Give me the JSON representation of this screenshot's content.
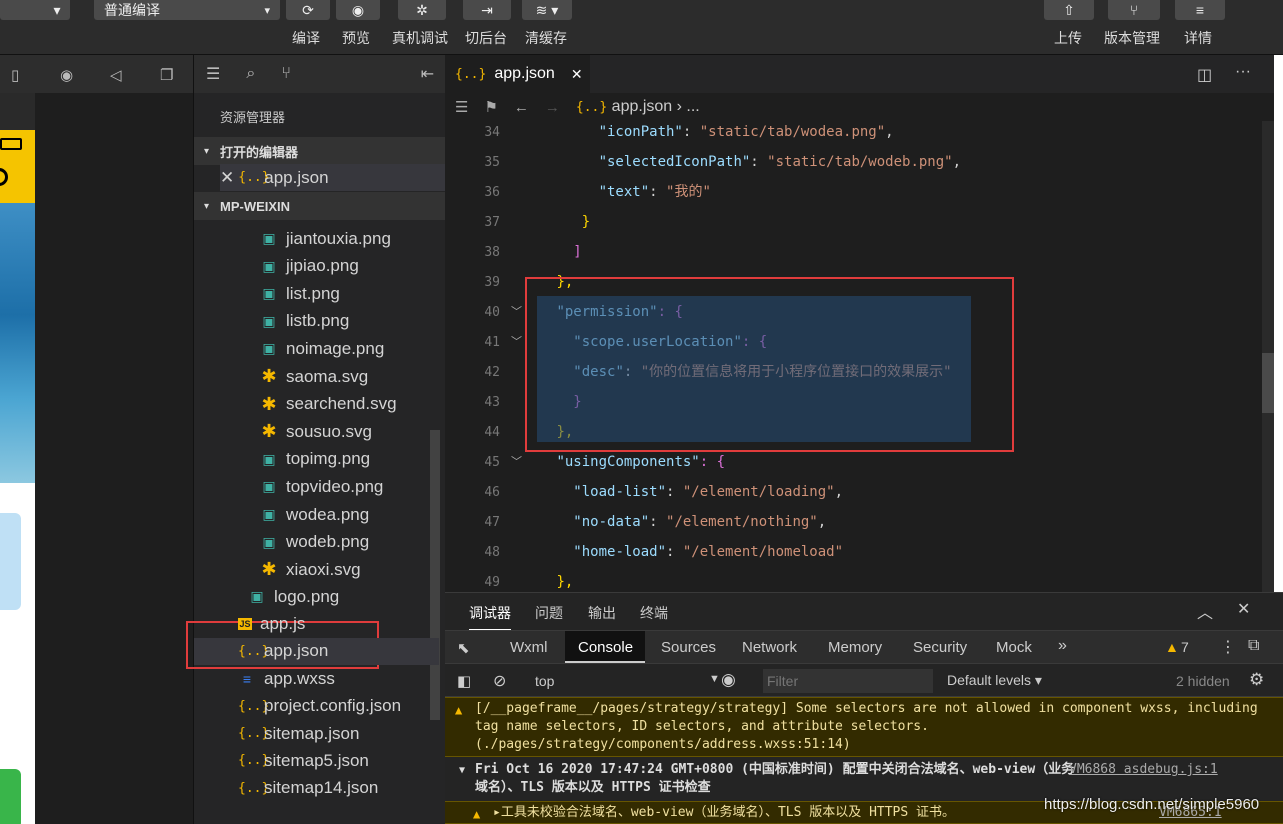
{
  "toolbar": {
    "compile_mode": "普通编译",
    "buttons": [
      "编译",
      "预览",
      "真机调试",
      "切后台",
      "清缓存"
    ],
    "right_buttons": [
      "上传",
      "版本管理",
      "详情"
    ]
  },
  "explorer": {
    "title": "资源管理器",
    "open_editors": "打开的编辑器",
    "open_file": "app.json",
    "project": "MP-WEIXIN",
    "files": [
      {
        "name": "jiantouxia.png",
        "type": "img"
      },
      {
        "name": "jipiao.png",
        "type": "img"
      },
      {
        "name": "list.png",
        "type": "img"
      },
      {
        "name": "listb.png",
        "type": "img"
      },
      {
        "name": "noimage.png",
        "type": "img"
      },
      {
        "name": "saoma.svg",
        "type": "svg"
      },
      {
        "name": "searchend.svg",
        "type": "svg"
      },
      {
        "name": "sousuo.svg",
        "type": "svg"
      },
      {
        "name": "topimg.png",
        "type": "img"
      },
      {
        "name": "topvideo.png",
        "type": "img"
      },
      {
        "name": "wodea.png",
        "type": "img"
      },
      {
        "name": "wodeb.png",
        "type": "img"
      },
      {
        "name": "xiaoxi.svg",
        "type": "svg"
      }
    ],
    "root_files": [
      {
        "name": "logo.png",
        "type": "img"
      },
      {
        "name": "app.js",
        "type": "js"
      },
      {
        "name": "app.json",
        "type": "json"
      },
      {
        "name": "app.wxss",
        "type": "css"
      },
      {
        "name": "project.config.json",
        "type": "json"
      },
      {
        "name": "sitemap.json",
        "type": "json"
      },
      {
        "name": "sitemap5.json",
        "type": "json"
      },
      {
        "name": "sitemap14.json",
        "type": "json"
      }
    ]
  },
  "editor": {
    "tab": "app.json",
    "breadcrumb": "app.json",
    "breadcrumb_more": "...",
    "lines": [
      {
        "n": "34",
        "indent": "      ",
        "key": "\"iconPath\"",
        "val": "\"static/tab/wodea.png\"",
        "tail": ","
      },
      {
        "n": "35",
        "indent": "      ",
        "key": "\"selectedIconPath\"",
        "val": "\"static/tab/wodeb.png\"",
        "tail": ","
      },
      {
        "n": "36",
        "indent": "      ",
        "key": "\"text\"",
        "val": "\"我的\"",
        "tail": ""
      },
      {
        "n": "37",
        "indent": "    ",
        "key": "",
        "val": "",
        "tail": "}"
      },
      {
        "n": "38",
        "indent": "   ",
        "key": "",
        "val": "",
        "tail": "]"
      },
      {
        "n": "39",
        "indent": " ",
        "key": "",
        "val": "",
        "tail": "},"
      },
      {
        "n": "40",
        "indent": " ",
        "key": "\"permission\"",
        "val": "",
        "tail": ": {"
      },
      {
        "n": "41",
        "indent": "   ",
        "key": "\"scope.userLocation\"",
        "val": "",
        "tail": ": {"
      },
      {
        "n": "42",
        "indent": "   ",
        "key": "\"desc\"",
        "val": "\"你的位置信息将用于小程序位置接口的效果展示\"",
        "tail": ""
      },
      {
        "n": "43",
        "indent": "   ",
        "key": "",
        "val": "",
        "tail": "}"
      },
      {
        "n": "44",
        "indent": " ",
        "key": "",
        "val": "",
        "tail": "},"
      },
      {
        "n": "45",
        "indent": " ",
        "key": "\"usingComponents\"",
        "val": "",
        "tail": ": {"
      },
      {
        "n": "46",
        "indent": "   ",
        "key": "\"load-list\"",
        "val": "\"/element/loading\"",
        "tail": ","
      },
      {
        "n": "47",
        "indent": "   ",
        "key": "\"no-data\"",
        "val": "\"/element/nothing\"",
        "tail": ","
      },
      {
        "n": "48",
        "indent": "   ",
        "key": "\"home-load\"",
        "val": "\"/element/homeload\"",
        "tail": ""
      },
      {
        "n": "49",
        "indent": " ",
        "key": "",
        "val": "",
        "tail": "},"
      }
    ]
  },
  "devtools": {
    "tabs": [
      "调试器",
      "问题",
      "输出",
      "终端"
    ],
    "panels": [
      "Wxml",
      "Console",
      "Sources",
      "Network",
      "Memory",
      "Security",
      "Mock"
    ],
    "warn_count": "7",
    "context": "top",
    "filter_placeholder": "Filter",
    "levels": "Default levels",
    "hidden": "2 hidden",
    "msg1": "[/__pageframe__/pages/strategy/strategy] Some selectors are not allowed in component wxss, including tag name selectors, ID selectors, and attribute selectors.(./pages/strategy/components/address.wxss:51:14)",
    "msg2": "Fri Oct 16 2020 17:47:24 GMT+0800 (中国标准时间) 配置中关闭合法域名、web-view（业务域名）、TLS 版本以及 HTTPS 证书检查",
    "msg2_src": "VM6868 asdebug.js:1",
    "msg3": "▸工具未校验合法域名、web-view（业务域名）、TLS 版本以及 HTTPS 证书。",
    "msg3_src": "VM6865:1"
  },
  "watermark": "https://blog.csdn.net/simple5960"
}
